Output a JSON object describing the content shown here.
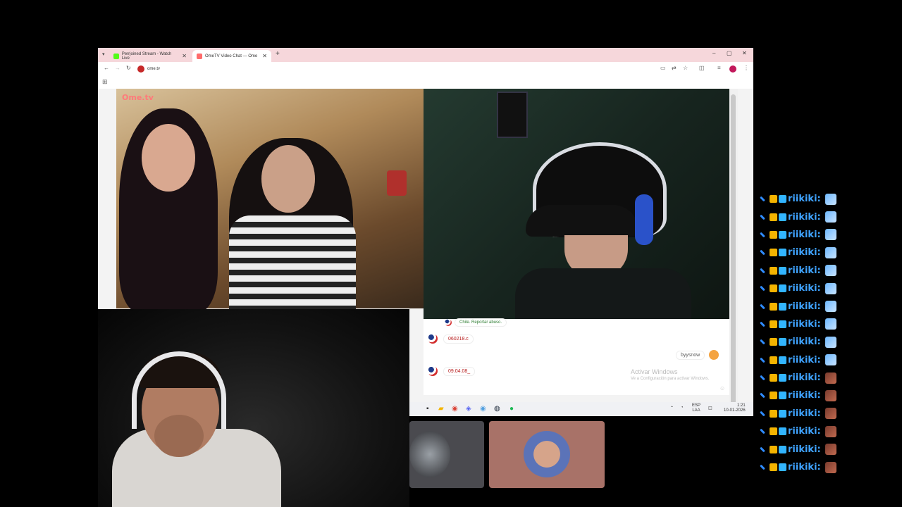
{
  "browser": {
    "tabs": [
      {
        "label": "Perrjoined Stream - Watch Live",
        "favicon_color": "#53fc18"
      },
      {
        "label": "OmeTV Video Chat — Ome",
        "favicon_color": "#ff6b6b"
      }
    ],
    "new_tab": "+",
    "window_controls": {
      "minimize": "–",
      "maximize": "▢",
      "close": "✕"
    },
    "nav": {
      "back": "←",
      "forward": "→",
      "reload": "↻"
    },
    "url": "ome.tv",
    "apps_icon": "⊞"
  },
  "omegle": {
    "logo": "Ome.tv",
    "chat": {
      "system_message": "Chile. Reportar abuso.",
      "messages": [
        {
          "text": "060218.c",
          "side": "left"
        },
        {
          "text": "byysnow",
          "side": "right"
        },
        {
          "text": "09.04.08_",
          "side": "left"
        }
      ],
      "watermark_title": "Activar Windows",
      "watermark_sub": "Ve a Configuración para activar Windows."
    }
  },
  "taskbar": {
    "lang": "ESP",
    "lang_sub": "LAA",
    "time": "1:21",
    "date": "10-01-2026"
  },
  "side_chat": {
    "username": "riikiki:",
    "rows": [
      {
        "emote": "a"
      },
      {
        "emote": "a"
      },
      {
        "emote": "a"
      },
      {
        "emote": "a"
      },
      {
        "emote": "a"
      },
      {
        "emote": "a"
      },
      {
        "emote": "a"
      },
      {
        "emote": "a"
      },
      {
        "emote": "a"
      },
      {
        "emote": "a"
      },
      {
        "emote": "b"
      },
      {
        "emote": "b"
      },
      {
        "emote": "b"
      },
      {
        "emote": "b"
      },
      {
        "emote": "b"
      },
      {
        "emote": "b"
      }
    ]
  },
  "colors": {
    "tabbar_bg": "#f6d7db",
    "chat_name": "#3fa3ff",
    "card_right": "#a87268",
    "card_left": "#4a4a4f"
  }
}
